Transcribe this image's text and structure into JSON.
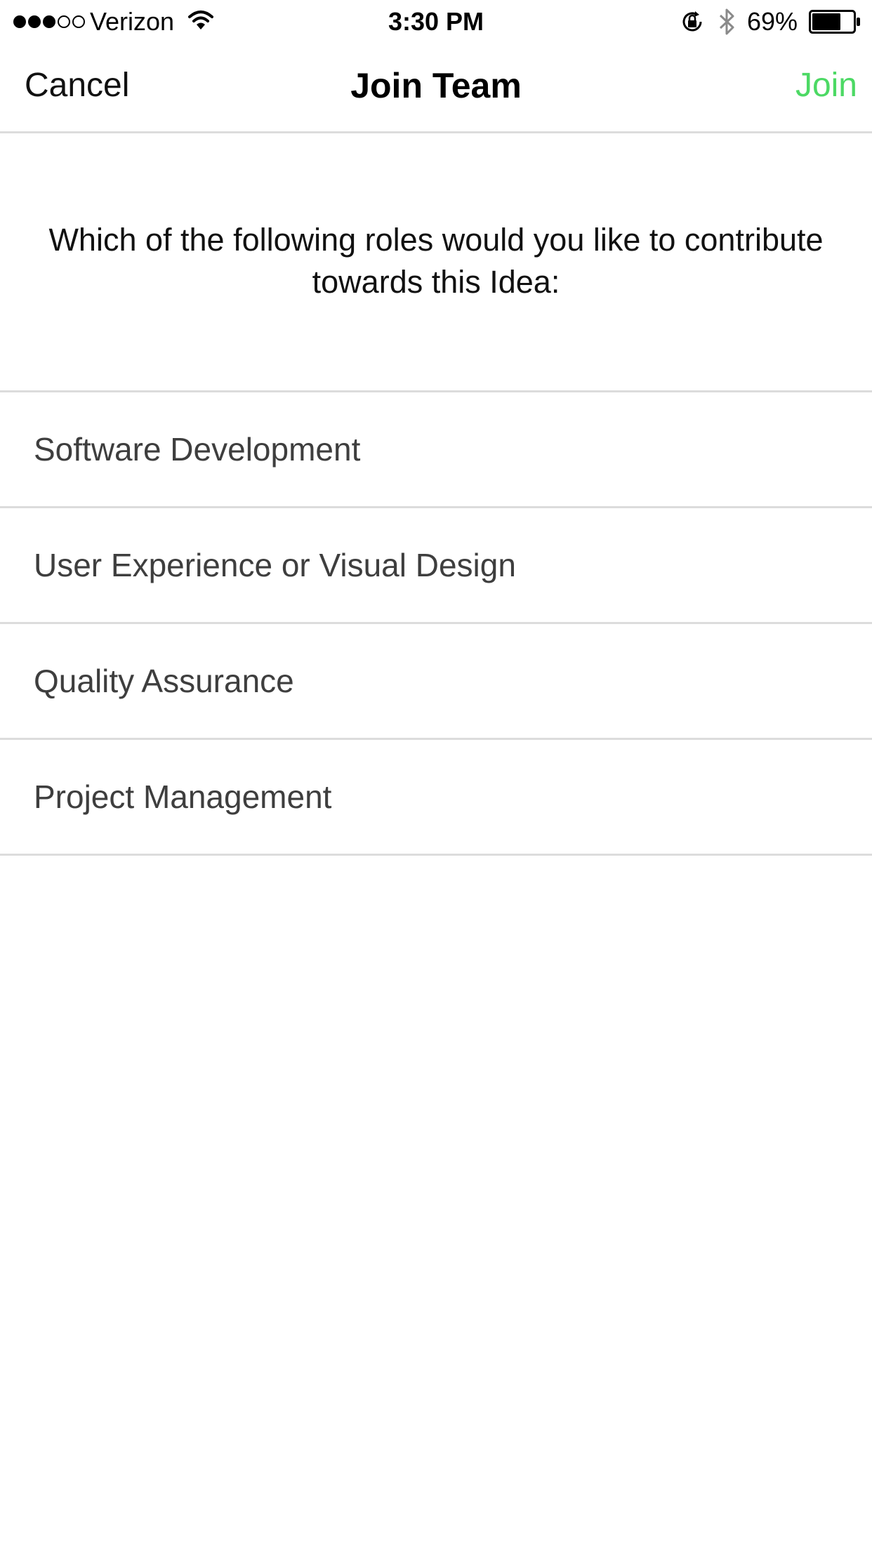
{
  "status_bar": {
    "carrier": "Verizon",
    "signal_bars_filled": 3,
    "signal_bars_total": 5,
    "time": "3:30 PM",
    "battery_percent": "69%",
    "battery_level": 0.69,
    "icons": [
      "signal-dots-icon",
      "wifi-icon",
      "rotation-lock-icon",
      "bluetooth-icon",
      "battery-icon"
    ]
  },
  "nav": {
    "cancel_label": "Cancel",
    "title": "Join Team",
    "join_label": "Join",
    "join_color": "#4cd964"
  },
  "prompt": {
    "text": "Which of the following roles would you like to contribute towards this Idea:"
  },
  "roles": [
    {
      "label": "Software Development"
    },
    {
      "label": "User Experience or Visual Design"
    },
    {
      "label": "Quality Assurance"
    },
    {
      "label": "Project Management"
    }
  ],
  "colors": {
    "accent": "#4cd964",
    "separator": "#dcdcdc",
    "role_text": "#3e3e3e"
  }
}
